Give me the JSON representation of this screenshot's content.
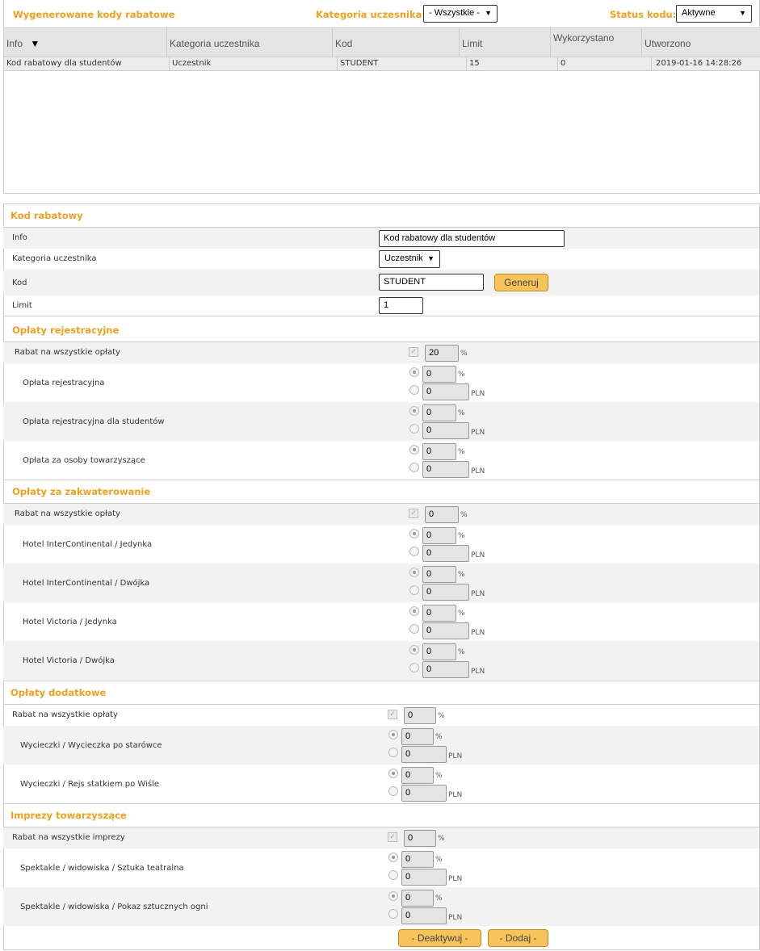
{
  "list": {
    "title": "Wygenerowane kody rabatowe",
    "kategoria_label": "Kategoria uczesnika:",
    "kategoria_value": "- Wszystkie -",
    "status_label": "Status kodu:",
    "status_value": "Aktywne",
    "columns": [
      "Info",
      "Kategoria uczestnika",
      "Kod",
      "Limit",
      "Wykorzystano",
      "Utworzono"
    ],
    "rows": [
      [
        "Kod rabatowy dla studentów",
        "Uczestnik",
        "STUDENT",
        "15",
        "0",
        "2019-01-16 14:28:26"
      ]
    ]
  },
  "form": {
    "title": "Kod rabatowy",
    "info_label": "Info",
    "info_value": "Kod rabatowy dla studentów",
    "kategoria_label": "Kategoria uczestnika",
    "kategoria_value": "Uczestnik",
    "kod_label": "Kod",
    "kod_value": "STUDENT",
    "generuj_label": "Generuj",
    "limit_label": "Limit",
    "limit_value": "1"
  },
  "units": {
    "percent": "%",
    "pln": "PLN"
  },
  "sections": {
    "rejestracyjne": {
      "title": "Opłaty rejestracyjne",
      "all_label": "Rabat na wszystkie opłaty",
      "all_value": "20",
      "items": [
        {
          "label": "Opłata rejestracyjna",
          "percent": "0",
          "pln": "0"
        },
        {
          "label": "Opłata rejestracyjna dla studentów",
          "percent": "0",
          "pln": "0"
        },
        {
          "label": "Opłata za osoby towarzyszące",
          "percent": "0",
          "pln": "0"
        }
      ]
    },
    "zakwaterowanie": {
      "title": "Opłaty za zakwaterowanie",
      "all_label": "Rabat na wszystkie opłaty",
      "all_value": "0",
      "items": [
        {
          "label": "Hotel InterContinental / Jedynka",
          "percent": "0",
          "pln": "0"
        },
        {
          "label": "Hotel InterContinental / Dwójka",
          "percent": "0",
          "pln": "0"
        },
        {
          "label": "Hotel Victoria / Jedynka",
          "percent": "0",
          "pln": "0"
        },
        {
          "label": "Hotel Victoria / Dwójka",
          "percent": "0",
          "pln": "0"
        }
      ]
    },
    "dodatkowe": {
      "title": "Opłaty dodatkowe",
      "all_label": "Rabat na wszystkie opłaty",
      "all_value": "0",
      "items": [
        {
          "label": "Wycieczki / Wycieczka po starówce",
          "percent": "0",
          "pln": "0"
        },
        {
          "label": "Wycieczki / Rejs statkiem po Wiśle",
          "percent": "0",
          "pln": "0"
        }
      ]
    },
    "imprezy": {
      "title": "Imprezy towarzyszące",
      "all_label": "Rabat na wszystkie imprezy",
      "all_value": "0",
      "items": [
        {
          "label": "Spektakle / widowiska / Sztuka teatralna",
          "percent": "0",
          "pln": "0"
        },
        {
          "label": "Spektakle / widowiska / Pokaz sztucznych ogni",
          "percent": "0",
          "pln": "0"
        }
      ]
    }
  },
  "actions": {
    "deaktywuj": "- Deaktywuj -",
    "dodaj": "- Dodaj -"
  }
}
